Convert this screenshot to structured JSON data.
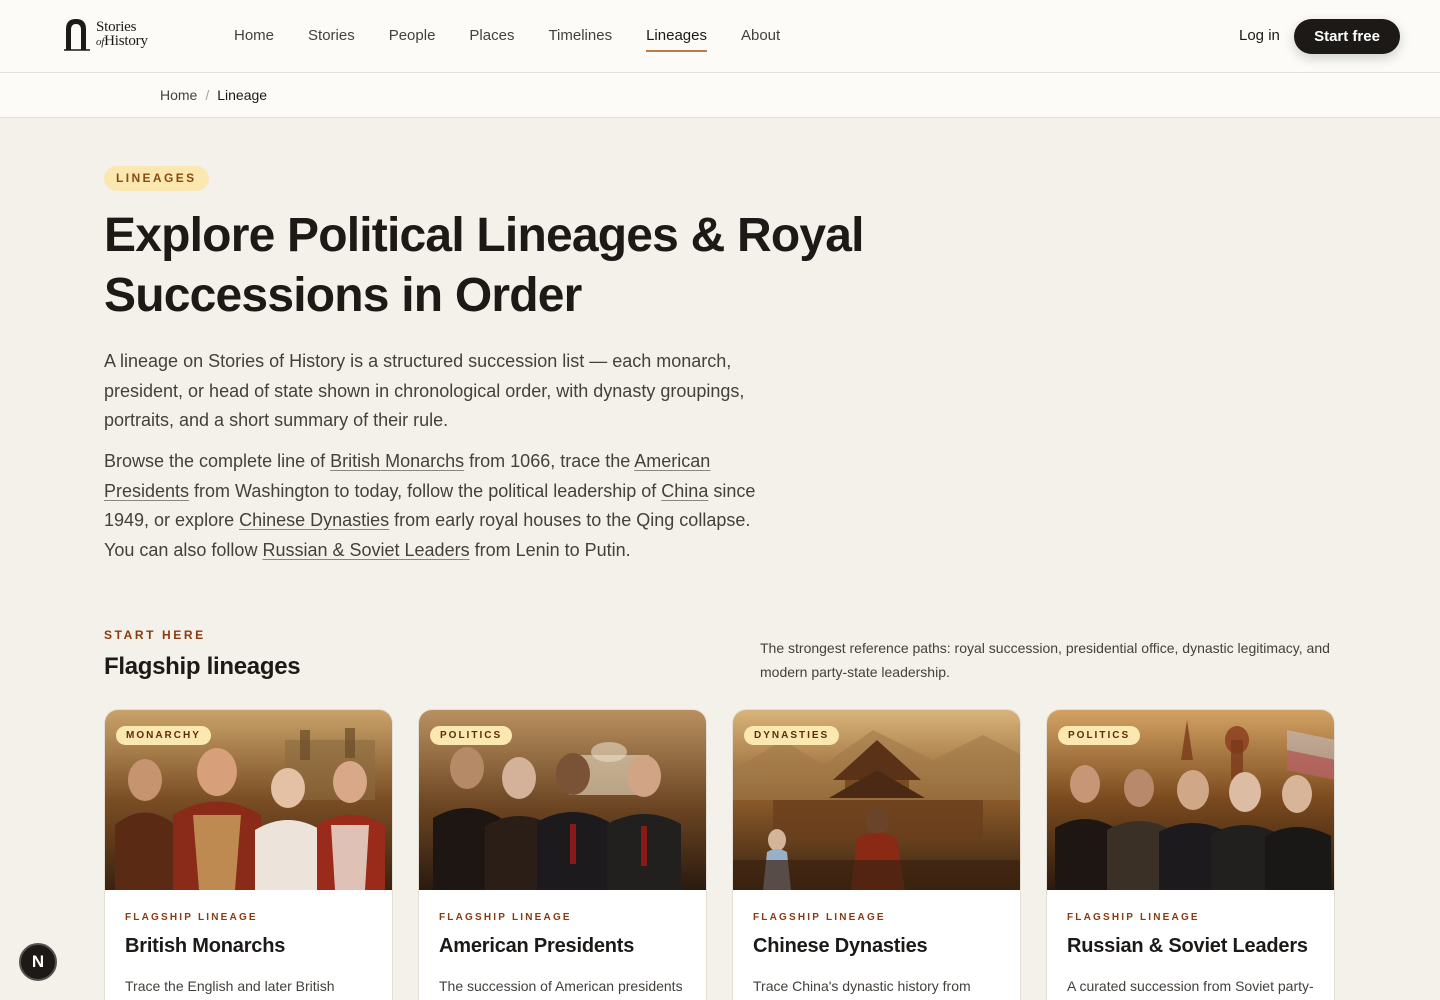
{
  "brand": {
    "line1": "Stories",
    "line2_of": "of",
    "line2": "History"
  },
  "nav": {
    "items": [
      "Home",
      "Stories",
      "People",
      "Places",
      "Timelines",
      "Lineages",
      "About"
    ],
    "active": "Lineages",
    "login": "Log in",
    "cta": "Start free"
  },
  "breadcrumb": {
    "home": "Home",
    "separator": "/",
    "current": "Lineage"
  },
  "hero": {
    "badge": "LINEAGES",
    "title": "Explore Political Lineages & Royal Successions in Order",
    "intro": "A lineage on Stories of History is a structured succession list — each monarch, president, or head of state shown in chronological order, with dynasty groupings, portraits, and a short summary of their rule.",
    "browse": {
      "t1": "Browse the complete line of ",
      "l1": "British Monarchs",
      "t2": " from 1066, trace the ",
      "l2": "American Presidents",
      "t3": " from Washington to today, follow the political leadership of ",
      "l3": "China",
      "t4": " since 1949, or explore ",
      "l4": "Chinese Dynasties",
      "t5": " from early royal houses to the Qing collapse. You can also follow ",
      "l5": "Russian & Soviet Leaders",
      "t6": " from Lenin to Putin."
    }
  },
  "section": {
    "eyebrow": "START HERE",
    "title": "Flagship lineages",
    "description": "The strongest reference paths: royal succession, presidential office, dynastic legitimacy, and modern party-state leadership."
  },
  "cards": [
    {
      "tag": "MONARCHY",
      "eyebrow": "FLAGSHIP LINEAGE",
      "title": "British Monarchs",
      "desc": "Trace the English and later British"
    },
    {
      "tag": "POLITICS",
      "eyebrow": "FLAGSHIP LINEAGE",
      "title": "American Presidents",
      "desc": "The succession of American presidents"
    },
    {
      "tag": "DYNASTIES",
      "eyebrow": "FLAGSHIP LINEAGE",
      "title": "Chinese Dynasties",
      "desc": "Trace China's dynastic history from"
    },
    {
      "tag": "POLITICS",
      "eyebrow": "FLAGSHIP LINEAGE",
      "title": "Russian & Soviet Leaders",
      "desc": "A curated succession from Soviet party-"
    }
  ],
  "floating": {
    "label": "N"
  },
  "colors": {
    "accent": "#c07a4a",
    "badge_bg": "#fbe7b0",
    "dark": "#1c1917",
    "page_bg": "#f4f1eb"
  }
}
